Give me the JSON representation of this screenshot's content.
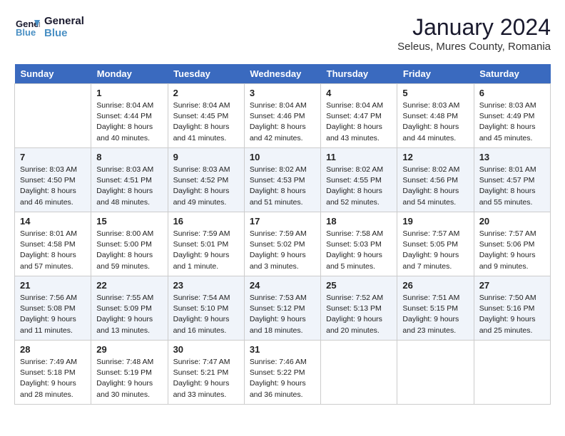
{
  "header": {
    "logo_line1": "General",
    "logo_line2": "Blue",
    "month": "January 2024",
    "location": "Seleus, Mures County, Romania"
  },
  "weekdays": [
    "Sunday",
    "Monday",
    "Tuesday",
    "Wednesday",
    "Thursday",
    "Friday",
    "Saturday"
  ],
  "weeks": [
    [
      {
        "day": "",
        "info": ""
      },
      {
        "day": "1",
        "info": "Sunrise: 8:04 AM\nSunset: 4:44 PM\nDaylight: 8 hours\nand 40 minutes."
      },
      {
        "day": "2",
        "info": "Sunrise: 8:04 AM\nSunset: 4:45 PM\nDaylight: 8 hours\nand 41 minutes."
      },
      {
        "day": "3",
        "info": "Sunrise: 8:04 AM\nSunset: 4:46 PM\nDaylight: 8 hours\nand 42 minutes."
      },
      {
        "day": "4",
        "info": "Sunrise: 8:04 AM\nSunset: 4:47 PM\nDaylight: 8 hours\nand 43 minutes."
      },
      {
        "day": "5",
        "info": "Sunrise: 8:03 AM\nSunset: 4:48 PM\nDaylight: 8 hours\nand 44 minutes."
      },
      {
        "day": "6",
        "info": "Sunrise: 8:03 AM\nSunset: 4:49 PM\nDaylight: 8 hours\nand 45 minutes."
      }
    ],
    [
      {
        "day": "7",
        "info": "Sunrise: 8:03 AM\nSunset: 4:50 PM\nDaylight: 8 hours\nand 46 minutes."
      },
      {
        "day": "8",
        "info": "Sunrise: 8:03 AM\nSunset: 4:51 PM\nDaylight: 8 hours\nand 48 minutes."
      },
      {
        "day": "9",
        "info": "Sunrise: 8:03 AM\nSunset: 4:52 PM\nDaylight: 8 hours\nand 49 minutes."
      },
      {
        "day": "10",
        "info": "Sunrise: 8:02 AM\nSunset: 4:53 PM\nDaylight: 8 hours\nand 51 minutes."
      },
      {
        "day": "11",
        "info": "Sunrise: 8:02 AM\nSunset: 4:55 PM\nDaylight: 8 hours\nand 52 minutes."
      },
      {
        "day": "12",
        "info": "Sunrise: 8:02 AM\nSunset: 4:56 PM\nDaylight: 8 hours\nand 54 minutes."
      },
      {
        "day": "13",
        "info": "Sunrise: 8:01 AM\nSunset: 4:57 PM\nDaylight: 8 hours\nand 55 minutes."
      }
    ],
    [
      {
        "day": "14",
        "info": "Sunrise: 8:01 AM\nSunset: 4:58 PM\nDaylight: 8 hours\nand 57 minutes."
      },
      {
        "day": "15",
        "info": "Sunrise: 8:00 AM\nSunset: 5:00 PM\nDaylight: 8 hours\nand 59 minutes."
      },
      {
        "day": "16",
        "info": "Sunrise: 7:59 AM\nSunset: 5:01 PM\nDaylight: 9 hours\nand 1 minute."
      },
      {
        "day": "17",
        "info": "Sunrise: 7:59 AM\nSunset: 5:02 PM\nDaylight: 9 hours\nand 3 minutes."
      },
      {
        "day": "18",
        "info": "Sunrise: 7:58 AM\nSunset: 5:03 PM\nDaylight: 9 hours\nand 5 minutes."
      },
      {
        "day": "19",
        "info": "Sunrise: 7:57 AM\nSunset: 5:05 PM\nDaylight: 9 hours\nand 7 minutes."
      },
      {
        "day": "20",
        "info": "Sunrise: 7:57 AM\nSunset: 5:06 PM\nDaylight: 9 hours\nand 9 minutes."
      }
    ],
    [
      {
        "day": "21",
        "info": "Sunrise: 7:56 AM\nSunset: 5:08 PM\nDaylight: 9 hours\nand 11 minutes."
      },
      {
        "day": "22",
        "info": "Sunrise: 7:55 AM\nSunset: 5:09 PM\nDaylight: 9 hours\nand 13 minutes."
      },
      {
        "day": "23",
        "info": "Sunrise: 7:54 AM\nSunset: 5:10 PM\nDaylight: 9 hours\nand 16 minutes."
      },
      {
        "day": "24",
        "info": "Sunrise: 7:53 AM\nSunset: 5:12 PM\nDaylight: 9 hours\nand 18 minutes."
      },
      {
        "day": "25",
        "info": "Sunrise: 7:52 AM\nSunset: 5:13 PM\nDaylight: 9 hours\nand 20 minutes."
      },
      {
        "day": "26",
        "info": "Sunrise: 7:51 AM\nSunset: 5:15 PM\nDaylight: 9 hours\nand 23 minutes."
      },
      {
        "day": "27",
        "info": "Sunrise: 7:50 AM\nSunset: 5:16 PM\nDaylight: 9 hours\nand 25 minutes."
      }
    ],
    [
      {
        "day": "28",
        "info": "Sunrise: 7:49 AM\nSunset: 5:18 PM\nDaylight: 9 hours\nand 28 minutes."
      },
      {
        "day": "29",
        "info": "Sunrise: 7:48 AM\nSunset: 5:19 PM\nDaylight: 9 hours\nand 30 minutes."
      },
      {
        "day": "30",
        "info": "Sunrise: 7:47 AM\nSunset: 5:21 PM\nDaylight: 9 hours\nand 33 minutes."
      },
      {
        "day": "31",
        "info": "Sunrise: 7:46 AM\nSunset: 5:22 PM\nDaylight: 9 hours\nand 36 minutes."
      },
      {
        "day": "",
        "info": ""
      },
      {
        "day": "",
        "info": ""
      },
      {
        "day": "",
        "info": ""
      }
    ]
  ]
}
